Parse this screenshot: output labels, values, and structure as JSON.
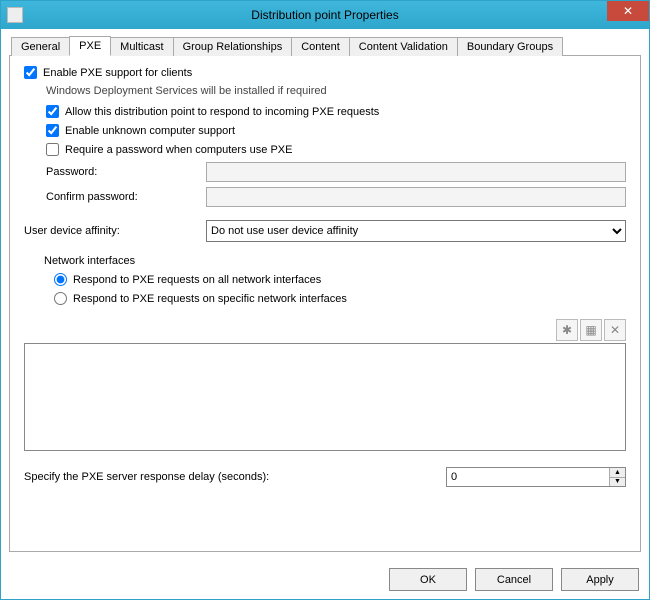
{
  "title": "Distribution point Properties",
  "tabs": {
    "general": "General",
    "pxe": "PXE",
    "multicast": "Multicast",
    "group_relationships": "Group Relationships",
    "content": "Content",
    "content_validation": "Content Validation",
    "boundary_groups": "Boundary Groups"
  },
  "pxe_panel": {
    "enable_pxe_label": "Enable PXE support for clients",
    "enable_pxe_checked": true,
    "wds_note": "Windows Deployment Services will be installed if required",
    "allow_respond_label": "Allow this distribution point to respond to incoming PXE requests",
    "allow_respond_checked": true,
    "unknown_support_label": "Enable unknown computer support",
    "unknown_support_checked": true,
    "require_password_label": "Require a password when computers use PXE",
    "require_password_checked": false,
    "password_label": "Password:",
    "password_value": "",
    "confirm_password_label": "Confirm password:",
    "confirm_password_value": "",
    "user_affinity_label": "User device affinity:",
    "user_affinity_value": "Do not use user device affinity",
    "network_interfaces_label": "Network interfaces",
    "radio_all_label": "Respond to PXE requests on all network interfaces",
    "radio_specific_label": "Respond to PXE requests on specific network interfaces",
    "radio_selection": "all",
    "interfaces_list": [],
    "delay_label": "Specify the PXE server response delay (seconds):",
    "delay_value": "0"
  },
  "icons": {
    "toolbar_new": "✱",
    "toolbar_props": "▦",
    "toolbar_delete": "✕"
  },
  "buttons": {
    "ok": "OK",
    "cancel": "Cancel",
    "apply": "Apply"
  }
}
